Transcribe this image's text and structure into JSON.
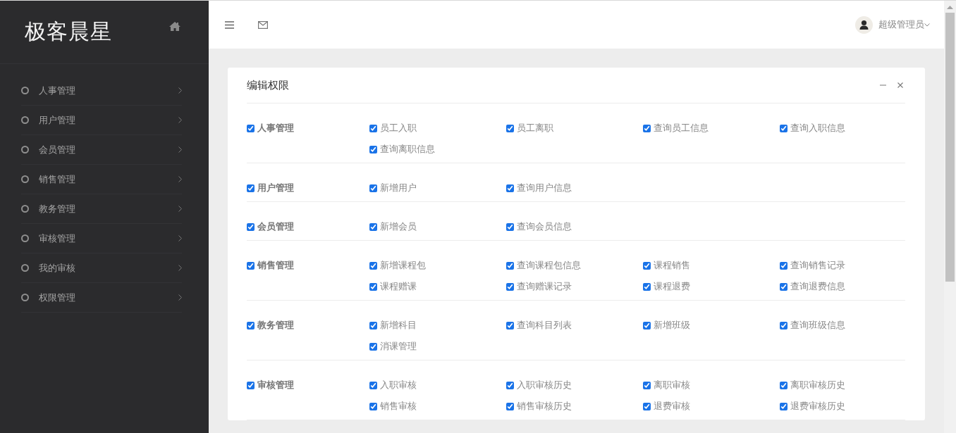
{
  "sidebar": {
    "logo": "极客晨星",
    "items": [
      {
        "label": "人事管理"
      },
      {
        "label": "用户管理"
      },
      {
        "label": "会员管理"
      },
      {
        "label": "销售管理"
      },
      {
        "label": "教务管理"
      },
      {
        "label": "审核管理"
      },
      {
        "label": "我的审核"
      },
      {
        "label": "权限管理"
      }
    ]
  },
  "header": {
    "user": "超级管理员"
  },
  "panel": {
    "title": "编辑权限",
    "groups": [
      {
        "label": "人事管理",
        "checked": true,
        "permissions": [
          {
            "label": "员工入职",
            "checked": true
          },
          {
            "label": "员工离职",
            "checked": true
          },
          {
            "label": "查询员工信息",
            "checked": true
          },
          {
            "label": "查询入职信息",
            "checked": true
          },
          {
            "label": "查询离职信息",
            "checked": true
          }
        ]
      },
      {
        "label": "用户管理",
        "checked": true,
        "permissions": [
          {
            "label": "新增用户",
            "checked": true
          },
          {
            "label": "查询用户信息",
            "checked": true
          }
        ]
      },
      {
        "label": "会员管理",
        "checked": true,
        "permissions": [
          {
            "label": "新增会员",
            "checked": true
          },
          {
            "label": "查询会员信息",
            "checked": true
          }
        ]
      },
      {
        "label": "销售管理",
        "checked": true,
        "permissions": [
          {
            "label": "新增课程包",
            "checked": true
          },
          {
            "label": "查询课程包信息",
            "checked": true
          },
          {
            "label": "课程销售",
            "checked": true
          },
          {
            "label": "查询销售记录",
            "checked": true
          },
          {
            "label": "课程赠课",
            "checked": true
          },
          {
            "label": "查询赠课记录",
            "checked": true
          },
          {
            "label": "课程退费",
            "checked": true
          },
          {
            "label": "查询退费信息",
            "checked": true
          }
        ]
      },
      {
        "label": "教务管理",
        "checked": true,
        "permissions": [
          {
            "label": "新增科目",
            "checked": true
          },
          {
            "label": "查询科目列表",
            "checked": true
          },
          {
            "label": "新增班级",
            "checked": true
          },
          {
            "label": "查询班级信息",
            "checked": true
          },
          {
            "label": "消课管理",
            "checked": true
          }
        ]
      },
      {
        "label": "审核管理",
        "checked": true,
        "permissions": [
          {
            "label": "入职审核",
            "checked": true
          },
          {
            "label": "入职审核历史",
            "checked": true
          },
          {
            "label": "离职审核",
            "checked": true
          },
          {
            "label": "离职审核历史",
            "checked": true
          },
          {
            "label": "销售审核",
            "checked": true
          },
          {
            "label": "销售审核历史",
            "checked": true
          },
          {
            "label": "退费审核",
            "checked": true
          },
          {
            "label": "退费审核历史",
            "checked": true
          }
        ]
      }
    ]
  }
}
